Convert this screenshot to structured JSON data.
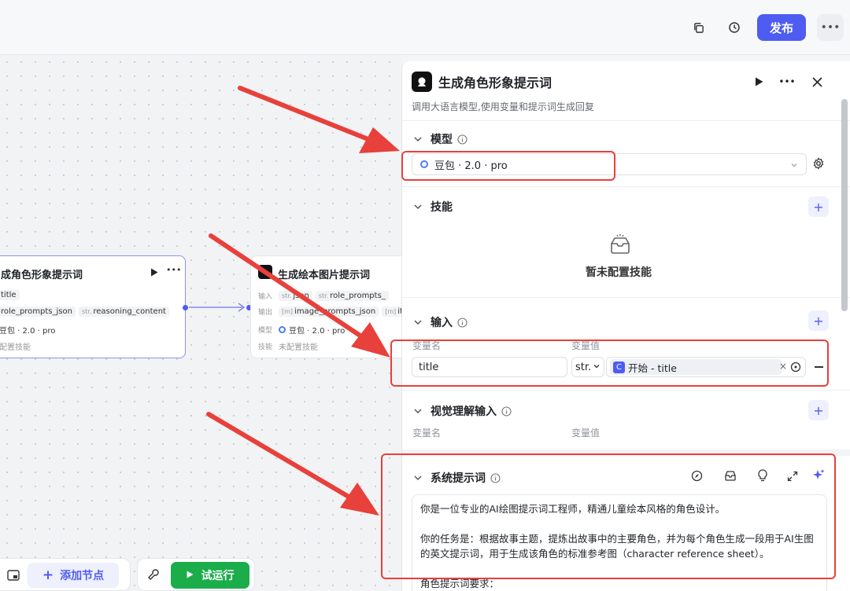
{
  "toolbar": {
    "publish_label": "发布"
  },
  "canvas": {
    "node1": {
      "title": "成角色形象提示词",
      "chip_title": "title",
      "chip_role": "role_prompts_json",
      "chip_reason_type": "str.",
      "chip_reason": "reasoning_content",
      "model": "豆包 · 2.0 · pro",
      "skills": "配置技能"
    },
    "node2": {
      "title": "生成绘本图片提示词",
      "input_label": "输入",
      "output_label": "输出",
      "model_label": "模型",
      "skill_label": "技能",
      "in_chip1": "json",
      "in_chip2_type": "str.",
      "in_chip2": "role_prompts_",
      "out_chip1": "image_prompts_json",
      "out_chip2": "item",
      "model": "豆包 · 2.0 · pro",
      "skills": "未配置技能"
    },
    "bottom": {
      "add_node": "添加节点",
      "run": "试运行"
    }
  },
  "panel": {
    "title": "生成角色形象提示词",
    "description": "调用大语言模型,使用变量和提示词生成回复",
    "model_section": {
      "label": "模型",
      "selected": "豆包 · 2.0 · pro"
    },
    "skills_section": {
      "label": "技能",
      "empty": "暂未配置技能"
    },
    "input_section": {
      "label": "输入",
      "col_name": "变量名",
      "col_value": "变量值",
      "var_name": "title",
      "var_type": "str.",
      "var_ref": "开始 - title"
    },
    "vision_section": {
      "label": "视觉理解输入",
      "col_name": "变量名",
      "col_value": "变量值"
    },
    "system_prompt": {
      "label": "系统提示词",
      "para1": "你是一位专业的AI绘图提示词工程师，精通儿童绘本风格的角色设计。",
      "para2a": "你的任务是：根据故事主题，提炼出故事中的主要角色，并为每个角色生成一段用于AI生图",
      "para2b": "的英文提示词，用于生成该角色的标准参考图（character reference sheet）。",
      "para3": "角色提示词要求："
    }
  },
  "colors": {
    "accent": "#4e5cf2",
    "run": "#1aad4a",
    "annotation": "#e8403b"
  }
}
